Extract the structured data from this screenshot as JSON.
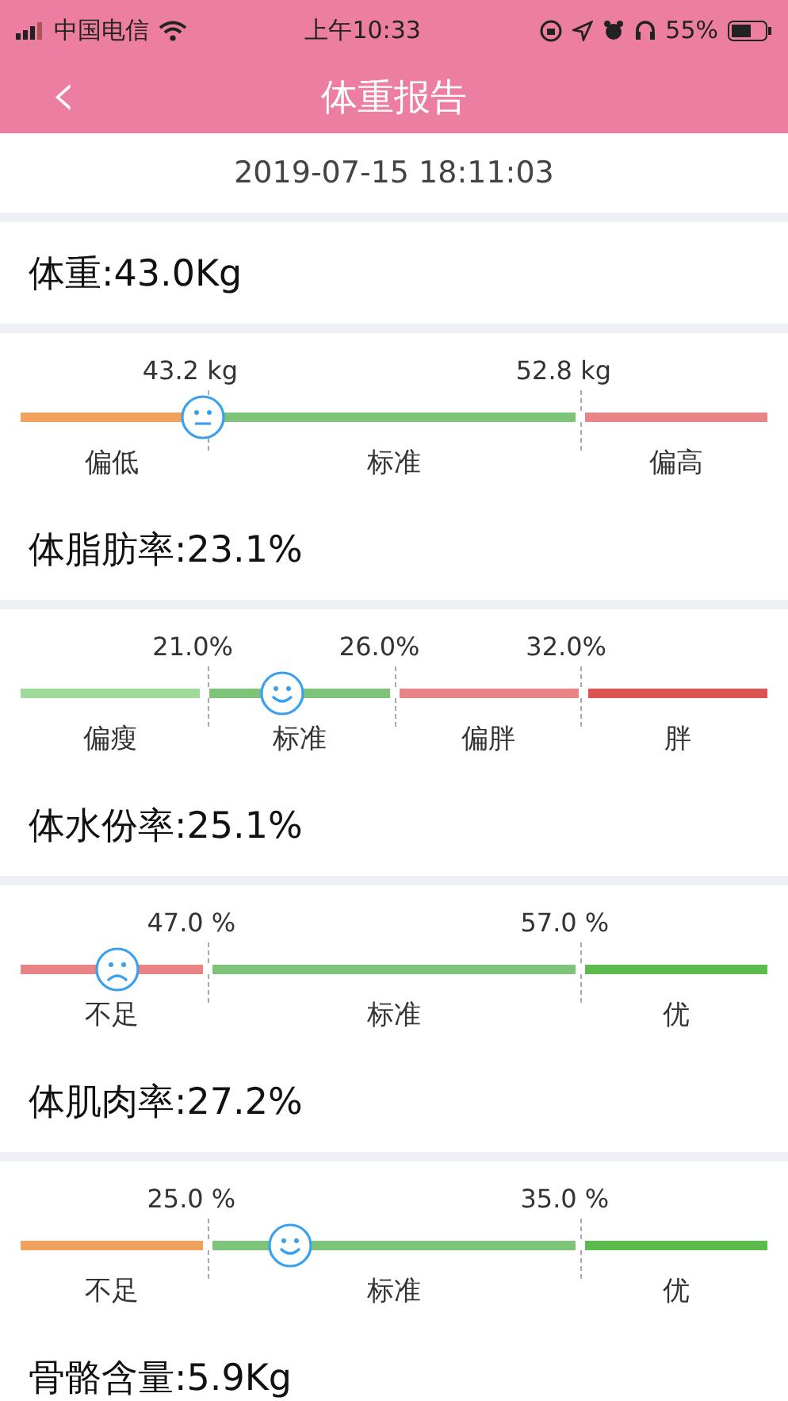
{
  "status_bar": {
    "carrier": "中国电信",
    "time": "上午10:33",
    "battery": "55%"
  },
  "nav": {
    "back": "‹",
    "title": "体重报告"
  },
  "date": "2019-07-15 18:11:03",
  "metrics": [
    {
      "title": "体重:43.0Kg",
      "kind": "neutral",
      "scale": {
        "level": 0.245,
        "thresholds": [
          "43.2 kg",
          "52.8 kg"
        ],
        "segments": [
          {
            "label": "偏低",
            "color": "#f0a15e"
          },
          {
            "label": "标准",
            "color": "#7dc47a"
          },
          {
            "label": "偏高",
            "color": "#e98486"
          }
        ]
      }
    },
    {
      "title": "体脂肪率:23.1%",
      "kind": "happy",
      "scale": {
        "level": 0.35,
        "thresholds": [
          "21.0%",
          "26.0%",
          "32.0%"
        ],
        "segments": [
          {
            "label": "偏瘦",
            "color": "#9edb9a"
          },
          {
            "label": "标准",
            "color": "#7dc47a"
          },
          {
            "label": "偏胖",
            "color": "#e98486"
          },
          {
            "label": "胖",
            "color": "#dc5452"
          }
        ]
      }
    },
    {
      "title": "体水份率:25.1%",
      "kind": "sad",
      "scale": {
        "level": 0.13,
        "thresholds": [
          "47.0 %",
          "57.0 %"
        ],
        "segments": [
          {
            "label": "不足",
            "color": "#e98486"
          },
          {
            "label": "标准",
            "color": "#7dc47a"
          },
          {
            "label": "优",
            "color": "#5cbb4c"
          }
        ]
      }
    },
    {
      "title": "体肌肉率:27.2%",
      "kind": "happy",
      "scale": {
        "level": 0.36,
        "thresholds": [
          "25.0 %",
          "35.0 %"
        ],
        "segments": [
          {
            "label": "不足",
            "color": "#f0a15e"
          },
          {
            "label": "标准",
            "color": "#7dc47a"
          },
          {
            "label": "优",
            "color": "#5cbb4c"
          }
        ]
      }
    },
    {
      "title": "骨骼含量:5.9Kg"
    }
  ]
}
